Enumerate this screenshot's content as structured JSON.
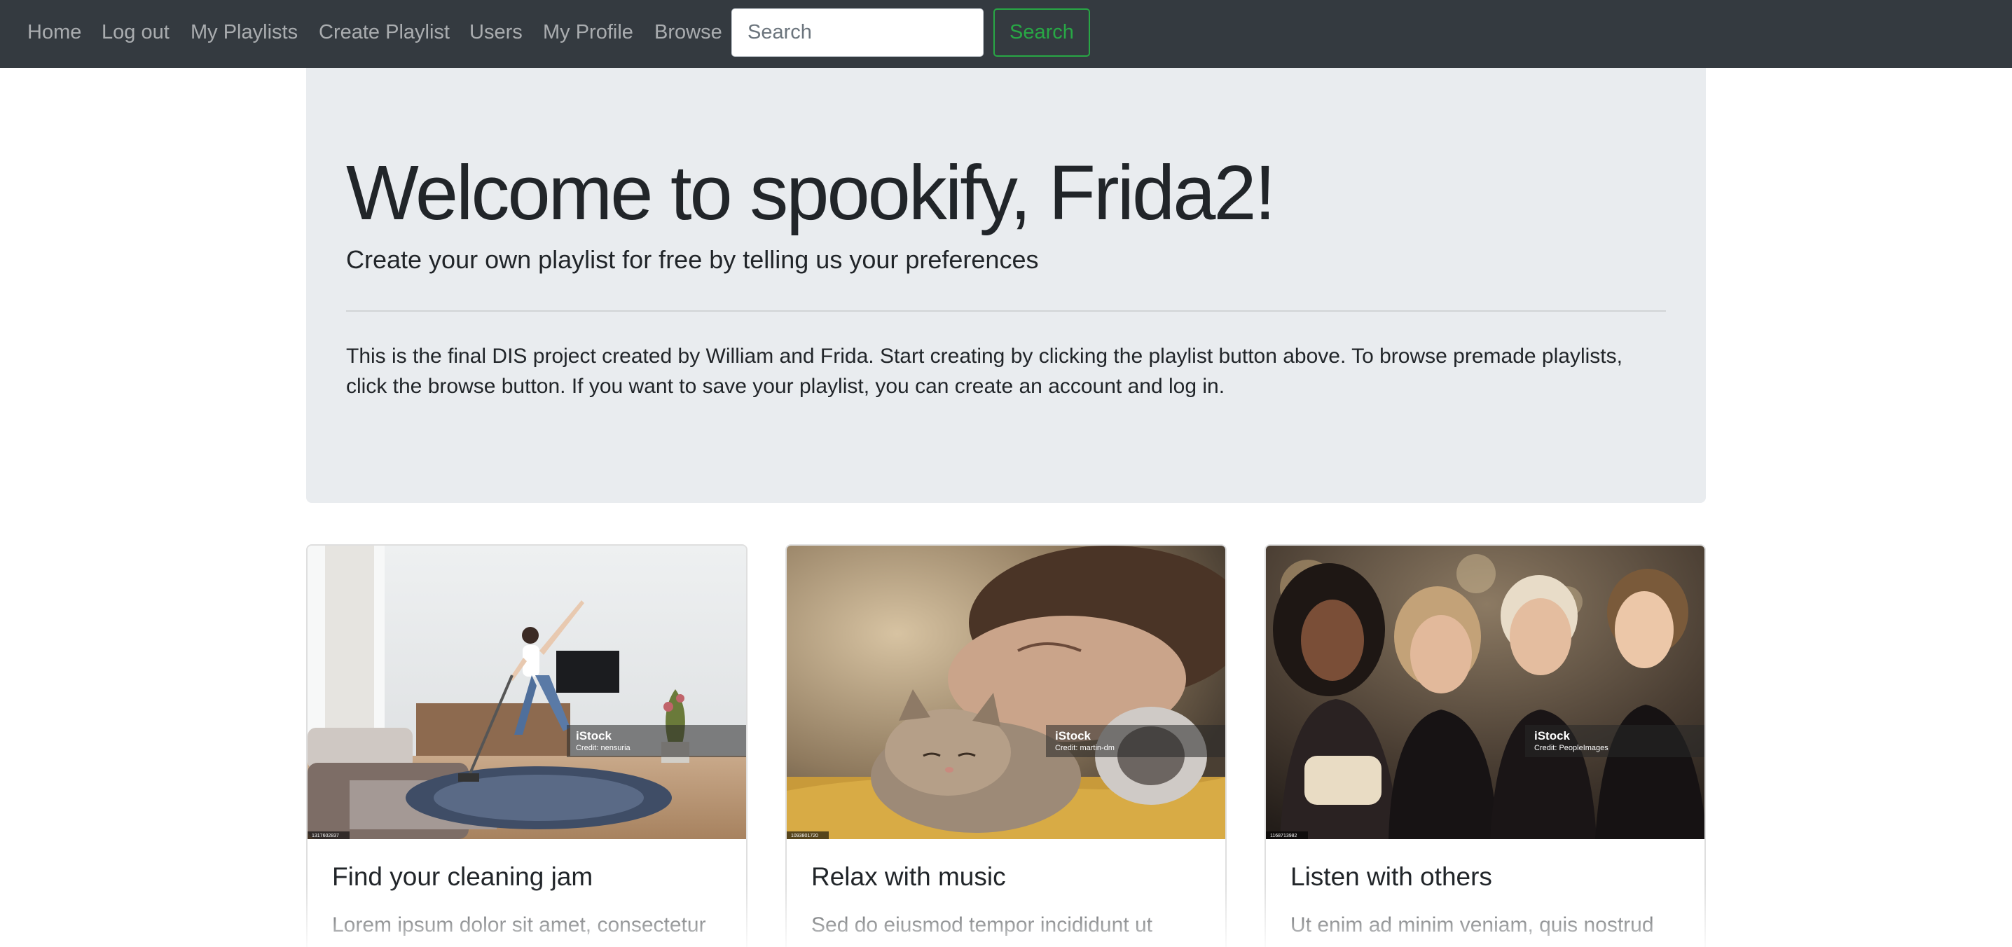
{
  "navbar": {
    "links": [
      {
        "label": "Home"
      },
      {
        "label": "Log out"
      },
      {
        "label": "My Playlists"
      },
      {
        "label": "Create Playlist"
      },
      {
        "label": "Users"
      },
      {
        "label": "My Profile"
      },
      {
        "label": "Browse"
      }
    ],
    "search": {
      "placeholder": "Search",
      "value": "",
      "button_label": "Search"
    },
    "colors": {
      "background": "#343a40",
      "link": "rgba(255,255,255,0.58)",
      "search_accent": "#28a745"
    }
  },
  "jumbotron": {
    "title": "Welcome to spookify, Frida2!",
    "lead": "Create your own playlist for free by telling us your preferences",
    "body": "This is the final DIS project created by William and Frida. Start creating by clicking the playlist button above. To browse premade playlists, click the browse button. If you want to save your playlist, you can create an account and log in.",
    "background": "#e9ecef"
  },
  "cards": [
    {
      "title": "Find your cleaning jam",
      "text": "Lorem ipsum dolor sit amet, consectetur adipiscing elit,",
      "image": {
        "watermark": "iStock",
        "credit": "Credit: nensuria",
        "id": "1317602837"
      }
    },
    {
      "title": "Relax with music",
      "text": "Sed do eiusmod tempor incididunt ut labore et dolore magna aliqua.",
      "image": {
        "watermark": "iStock",
        "credit": "Credit: martin-dm",
        "id": "1093801720"
      }
    },
    {
      "title": "Listen with others",
      "text": "Ut enim ad minim veniam, quis nostrud exercitation ullamco laboris",
      "image": {
        "watermark": "iStock",
        "credit": "Credit: PeopleImages",
        "id": "1168713982"
      }
    }
  ]
}
